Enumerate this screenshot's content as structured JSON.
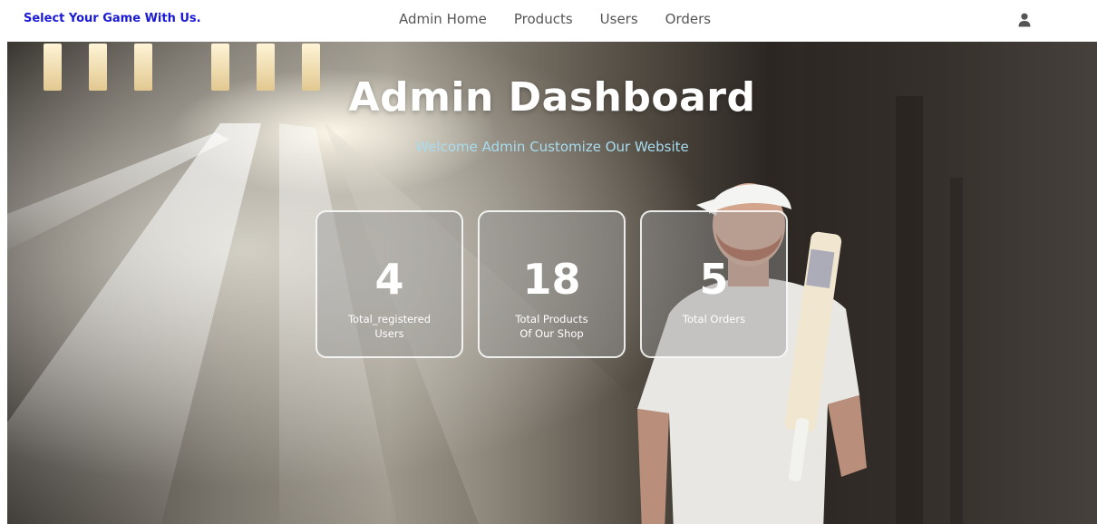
{
  "navbar": {
    "brand": "Select Your Game With Us.",
    "links": [
      "Admin Home",
      "Products",
      "Users",
      "Orders"
    ],
    "user_icon": "user-icon"
  },
  "hero": {
    "title": "Admin Dashboard",
    "subtitle": "Welcome Admin Customize Our Website"
  },
  "stats": [
    {
      "value": "4",
      "label_line1": "Total_registered",
      "label_line2": "Users"
    },
    {
      "value": "18",
      "label_line1": "Total Products",
      "label_line2": "Of Our Shop"
    },
    {
      "value": "5",
      "label_line1": "Total Orders",
      "label_line2": ""
    }
  ],
  "colors": {
    "brand": "#1a1ad6",
    "subtitle": "#a8dcef",
    "nav_text": "#555555"
  }
}
